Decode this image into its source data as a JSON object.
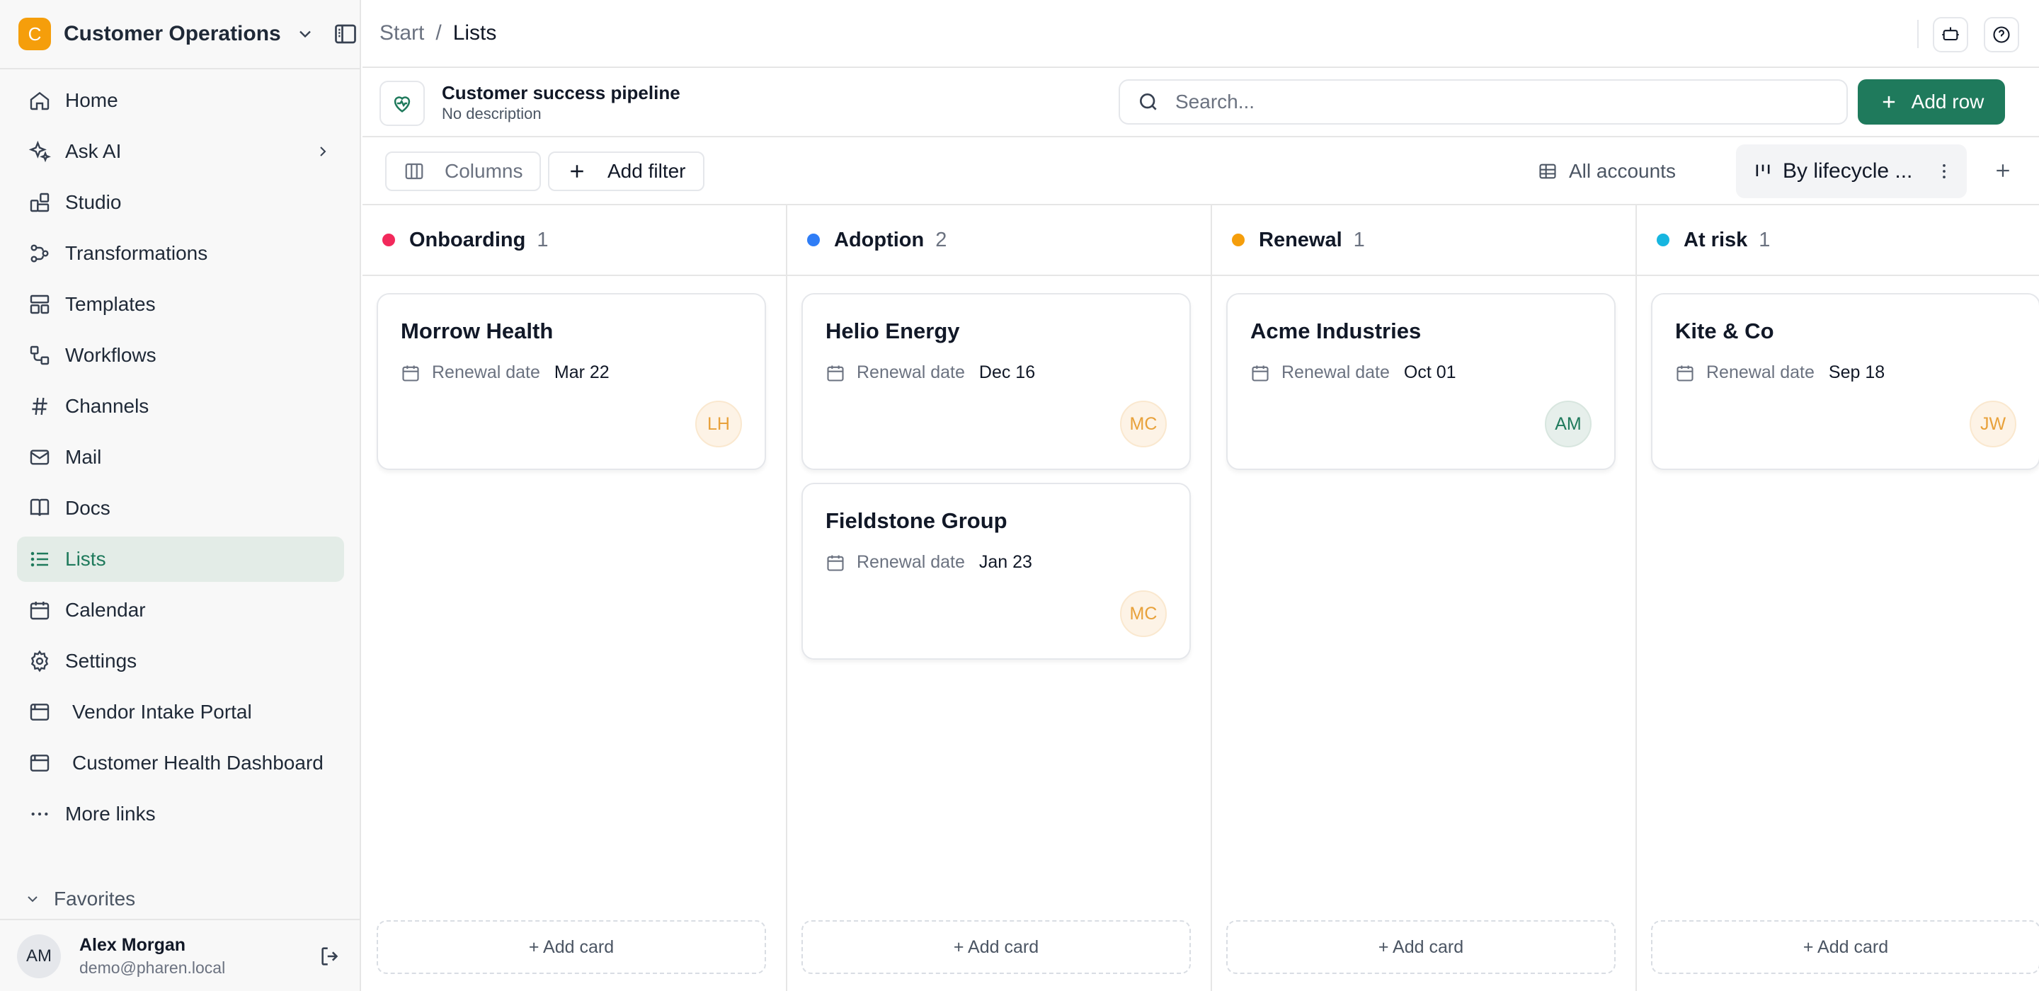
{
  "workspace": {
    "initial": "C",
    "name": "Customer Operations"
  },
  "sidebar": {
    "items": [
      {
        "label": "Home",
        "icon": "home-icon"
      },
      {
        "label": "Ask AI",
        "icon": "sparkles-icon"
      },
      {
        "label": "Studio",
        "icon": "studio-icon"
      },
      {
        "label": "Transformations",
        "icon": "transformations-icon"
      },
      {
        "label": "Templates",
        "icon": "templates-icon"
      },
      {
        "label": "Workflows",
        "icon": "workflows-icon"
      },
      {
        "label": "Channels",
        "icon": "hash-icon"
      },
      {
        "label": "Mail",
        "icon": "mail-icon"
      },
      {
        "label": "Docs",
        "icon": "book-icon"
      },
      {
        "label": "Lists",
        "icon": "list-icon"
      },
      {
        "label": "Calendar",
        "icon": "calendar-icon"
      },
      {
        "label": "Settings",
        "icon": "gear-icon"
      },
      {
        "label": "Vendor Intake Portal",
        "icon": "app-window-icon"
      },
      {
        "label": "Customer Health Dashboard",
        "icon": "app-window-icon"
      },
      {
        "label": "More links",
        "icon": "more-horizontal-icon"
      }
    ],
    "active": "Lists",
    "favorites_label": "Favorites"
  },
  "user": {
    "initials": "AM",
    "name": "Alex Morgan",
    "email": "demo@pharen.local"
  },
  "breadcrumb": {
    "root": "Start",
    "sep": "/",
    "current": "Lists"
  },
  "list": {
    "title": "Customer success pipeline",
    "description": "No description",
    "search_placeholder": "Search...",
    "add_row_label": "Add row"
  },
  "toolbar": {
    "columns_label": "Columns",
    "add_filter_label": "Add filter",
    "views": {
      "all": "All accounts",
      "active": "By lifecycle ..."
    }
  },
  "board": {
    "columns": [
      {
        "name": "Onboarding",
        "count": "1",
        "color": "#f2295b",
        "cards": [
          {
            "title": "Morrow Health",
            "meta_label": "Renewal date",
            "meta_value": "Mar 22",
            "owner": "LH"
          }
        ]
      },
      {
        "name": "Adoption",
        "count": "2",
        "color": "#2f7df6",
        "cards": [
          {
            "title": "Helio Energy",
            "meta_label": "Renewal date",
            "meta_value": "Dec 16",
            "owner": "MC"
          },
          {
            "title": "Fieldstone Group",
            "meta_label": "Renewal date",
            "meta_value": "Jan 23",
            "owner": "MC"
          }
        ]
      },
      {
        "name": "Renewal",
        "count": "1",
        "color": "#f59e0b",
        "cards": [
          {
            "title": "Acme Industries",
            "meta_label": "Renewal date",
            "meta_value": "Oct 01",
            "owner": "AM"
          }
        ]
      },
      {
        "name": "At risk",
        "count": "1",
        "color": "#17b6e0",
        "cards": [
          {
            "title": "Kite & Co",
            "meta_label": "Renewal date",
            "meta_value": "Sep 18",
            "owner": "JW"
          }
        ]
      }
    ],
    "add_card_label": "+ Add card"
  },
  "colors": {
    "accent": "#1f7a5c",
    "workspace_logo": "#f59e0b",
    "active_nav_bg": "#e3ece7"
  }
}
